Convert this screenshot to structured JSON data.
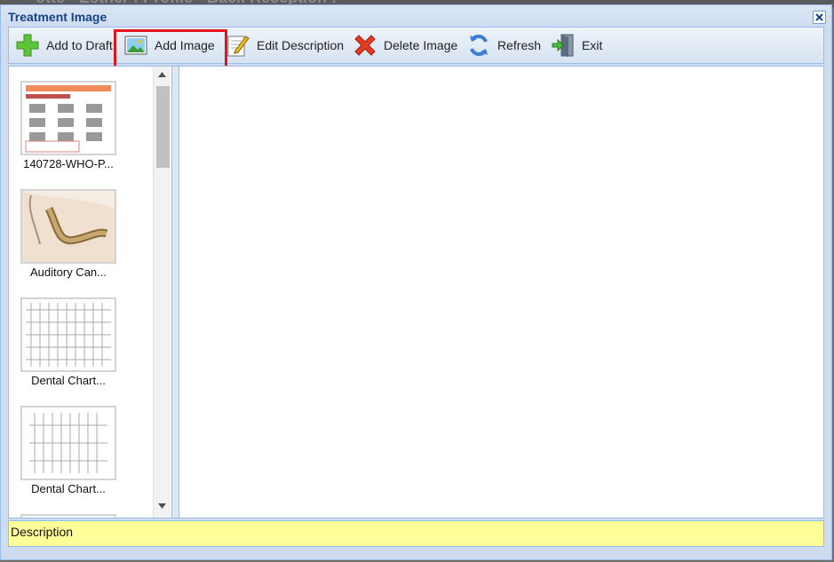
{
  "backdrop": {
    "text": "otte - Esther : Profile - Back Reception :"
  },
  "window": {
    "title": "Treatment Image"
  },
  "toolbar": {
    "add_to_draft": "Add to Draft",
    "add_image": "Add Image",
    "edit_description": "Edit Description",
    "delete_image": "Delete Image",
    "refresh": "Refresh",
    "exit": "Exit"
  },
  "thumbnails": [
    {
      "label": "140728-WHO-P..."
    },
    {
      "label": "Auditory Can..."
    },
    {
      "label": "Dental Chart..."
    },
    {
      "label": "Dental Chart..."
    }
  ],
  "description": {
    "label": "Description"
  },
  "colors": {
    "highlight": "#e3141c",
    "description_bg": "#ffff99",
    "title_text": "#15428b"
  }
}
